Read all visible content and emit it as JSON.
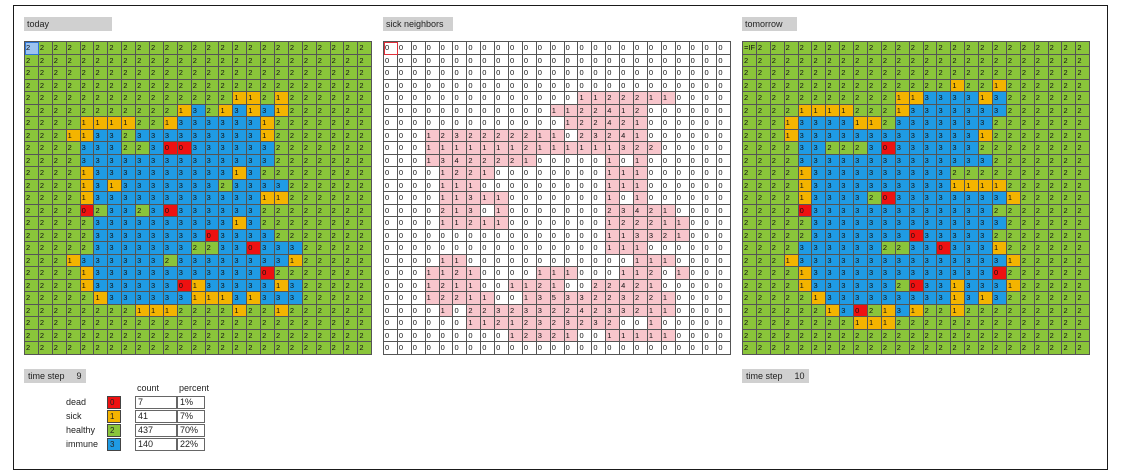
{
  "labels": {
    "today": "today",
    "sick_neighbors": "sick neighbors",
    "tomorrow": "tomorrow"
  },
  "colors": {
    "dead": "#ee1111",
    "sick": "#f4b400",
    "healthy": "#8ac53a",
    "immune": "#1f9be4",
    "neighbor_highlight": "#f8c6cc"
  },
  "today_grid": [
    "2222222222222222222222222",
    "2222222222222222222222222",
    "2222222222222222222222222",
    "2222222222222222222222222",
    "2222222222222221121222222",
    "2222222222213213131222222",
    "2222111122133333312222222",
    "2221133233333333312222222",
    "2222333223003333332222222",
    "2222333333333333332222222",
    "2222133333333331322222222",
    "2222131333333323333222222",
    "2222133333333333311222222",
    "2222023323033333322222222",
    "2222233333333331322222222",
    "2222233333333033332222222",
    "2222233333332233033322222",
    "2221333333233333333122222",
    "2222133333333333302222222",
    "2222133333301333331322222",
    "2222213333331113133322222",
    "2222222211122221221222222",
    "2222222222222222222222222",
    "2222222222222222222222222",
    "2222222222222222222222222"
  ],
  "neighbors_grid": [
    "0000000000000000000000000",
    "0000000000000000000000000",
    "0000000000000000000000000",
    "0000000000000000000000000",
    "0000000000000011222110000",
    "0000000000001122412000000",
    "0000000000000122421000000",
    "0001232222211023241000000",
    "0001111111211111132200000",
    "0001342222100000101000000",
    "0000122100000000111000000",
    "0000111000000000111000000",
    "0000113110000000101000000",
    "0000213010000000234210000",
    "0000112110000000122211000",
    "0000000000000000113321000",
    "0000000000000000111000000",
    "0000110000000000001110000",
    "0001121000011100011201000",
    "0001211001121002242100000",
    "0001221100135332232210000",
    "0000102232332242332110000",
    "0000001121232323200100000",
    "0000000001232100111110000",
    "0000000000000000000000000"
  ],
  "tomorrow_grid": [
    "2222222222222222222222222",
    "2222222222222222222222222",
    "2222222222222222222222222",
    "2222222222222221221222222",
    "2222222222211333313222222",
    "2222111122213333333222222",
    "2221333311233333332222222",
    "2221333333333333312222222",
    "2222332223033333322222222",
    "2222333333333333332222222",
    "2222133333333332222222222",
    "2222133333333331111222222",
    "2222133332033333333122222",
    "2222033333333333332222222",
    "2222233333333333333222222",
    "2222233333330333332222222",
    "2222333333223303331222222",
    "2221333333333333333122222",
    "2222133333333333330222222",
    "2222133333320331333122222",
    "2222213333333331313222222",
    "2222221302131221222222222",
    "2222222211122222222222222",
    "2222222222222222222222222",
    "2222222222222222222222222"
  ],
  "today_first_cell": "2",
  "neighbors_first_cell": "0",
  "tomorrow_first_cell": "=IF",
  "time_step_today": {
    "label": "time step",
    "value": "9"
  },
  "time_step_tomorrow": {
    "label": "time step",
    "value": "10"
  },
  "legend": {
    "count_header": "count",
    "percent_header": "percent",
    "rows": [
      {
        "name": "dead",
        "code": "0",
        "count": "7",
        "percent": "1%"
      },
      {
        "name": "sick",
        "code": "1",
        "count": "41",
        "percent": "7%"
      },
      {
        "name": "healthy",
        "code": "2",
        "count": "437",
        "percent": "70%"
      },
      {
        "name": "immune",
        "code": "3",
        "count": "140",
        "percent": "22%"
      }
    ]
  }
}
